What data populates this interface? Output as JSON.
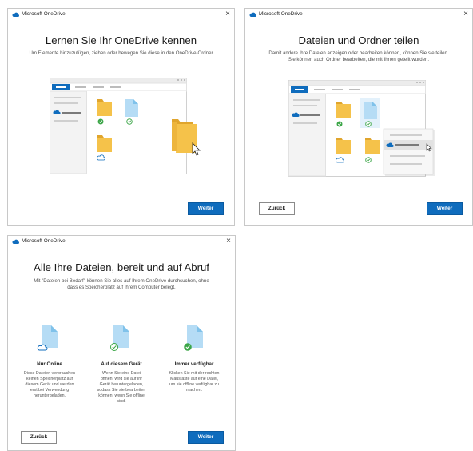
{
  "app": {
    "title": "Microsoft OneDrive",
    "close_glyph": "×",
    "icon": "onedrive-cloud-icon"
  },
  "screens": [
    {
      "title": "Lernen Sie Ihr OneDrive kennen",
      "subtitle": "Um Elemente hinzuzufügen, ziehen oder bewegen Sie diese in den OneDrive-Ordner",
      "next_label": "Weiter"
    },
    {
      "title": "Dateien und Ordner teilen",
      "subtitle_lines": [
        "Damit andere Ihre Dateien anzeigen oder bearbeiten können, können Sie sie teilen.",
        "Sie können auch Ordner bearbeiten, die mit Ihnen geteilt wurden."
      ],
      "back_label": "Zurück",
      "next_label": "Weiter"
    },
    {
      "title": "Alle Ihre Dateien, bereit und auf Abruf",
      "subtitle_lines": [
        "Mit \"Dateien bei Bedarf\" können Sie alles auf Ihrem OneDrive durchsuchen, ohne",
        "dass es Speicherplatz auf Ihrem Computer belegt."
      ],
      "columns": [
        {
          "title": "Nur Online",
          "icon": "cloud-status-icon",
          "desc_lines": [
            "Diese Dateien verbrauchen",
            "keinen Speicherplatz auf",
            "diesem Gerät und werden",
            "erst bei Verwendung",
            "heruntergeladen."
          ]
        },
        {
          "title": "Auf diesem Gerät",
          "icon": "check-outline-status-icon",
          "desc_lines": [
            "Wenn Sie eine Datei",
            "öffnen, wird sie auf Ihr",
            "Gerät heruntergeladen,",
            "sodass Sie sie bearbeiten",
            "können, wenn Sie offline",
            "sind."
          ]
        },
        {
          "title": "Immer verfügbar",
          "icon": "check-filled-status-icon",
          "desc_lines": [
            "Klicken Sie mit der rechten",
            "Maustaste auf eine Datei,",
            "um sie offline verfügbar zu",
            "machen."
          ]
        }
      ],
      "back_label": "Zurück",
      "next_label": "Weiter"
    }
  ],
  "colors": {
    "accent": "#0f6cbd",
    "folder": "#f5c24a",
    "folder_dark": "#e0a52d",
    "file": "#b5dcf5",
    "file_fold": "#80c2ea",
    "success": "#3ca648",
    "cloud": "#0f6cbd"
  }
}
